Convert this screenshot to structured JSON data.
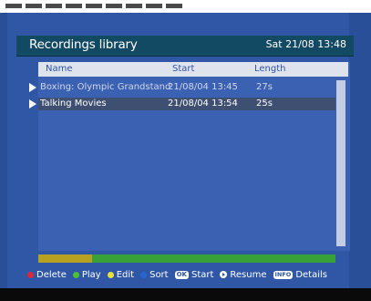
{
  "header": {
    "title": "Recordings library",
    "datetime": "Sat 21/08 13:48"
  },
  "columns": {
    "name": "Name",
    "start": "Start",
    "length": "Length"
  },
  "recordings": [
    {
      "name": "Boxing: Olympic Grandstand",
      "start": "21/08/04  13:45",
      "length": "27s",
      "selected": false
    },
    {
      "name": "Talking Movies",
      "start": "21/08/04  13:54",
      "length": "25s",
      "selected": true
    }
  ],
  "progress": {
    "fraction": 0.18,
    "fill_color": "#b8a020",
    "track_color": "#38a138"
  },
  "legend": [
    {
      "kind": "dot",
      "icon": "red-button-icon",
      "color": "#d8283a",
      "label": "Delete"
    },
    {
      "kind": "dot",
      "icon": "green-button-icon",
      "color": "#4fbf3a",
      "label": "Play"
    },
    {
      "kind": "dot",
      "icon": "yellow-button-icon",
      "color": "#e8e040",
      "label": "Edit"
    },
    {
      "kind": "dot",
      "icon": "blue-button-icon",
      "color": "#2a64d0",
      "label": "Sort"
    },
    {
      "kind": "badge",
      "icon": "ok-key-icon",
      "badge": "OK",
      "label": "Start"
    },
    {
      "kind": "play",
      "icon": "play-key-icon",
      "label": "Resume"
    },
    {
      "kind": "badge",
      "icon": "info-key-icon",
      "badge": "INFO",
      "label": "Details"
    }
  ],
  "colors": {
    "background": "#2f57a6",
    "header": "#134a63",
    "selected_row": "#3f4f72"
  }
}
